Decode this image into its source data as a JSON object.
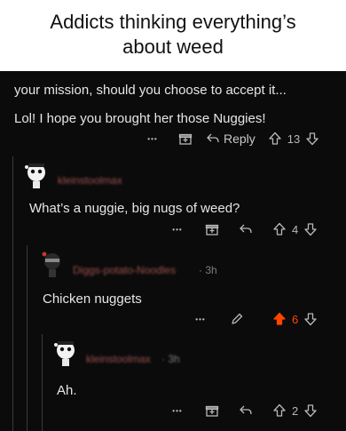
{
  "caption": {
    "line1": "Addicts thinking everything’s",
    "line2": "about weed"
  },
  "comments": [
    {
      "text": "your mission, should you choose to accept it...",
      "actions": {}
    },
    {
      "text": "Lol! I hope you brought her those Nuggies!",
      "actions": {
        "more": "•••",
        "reply": "Reply",
        "score": "13"
      }
    },
    {
      "user": "kleinstoolmax",
      "time": "",
      "text": "What’s a nuggie, big nugs of weed?",
      "actions": {
        "more": "•••",
        "score": "4"
      }
    },
    {
      "user": "Diggs-potato-Noodles",
      "time": "· 3h",
      "text": "Chicken nuggets",
      "actions": {
        "more": "•••",
        "score": "6",
        "upvoted": true
      }
    },
    {
      "user": "kleinstoolmax",
      "time": "· 3h",
      "text": "Ah.",
      "actions": {
        "more": "•••",
        "score": "2"
      }
    }
  ],
  "colors": {
    "background": "#0b0b0b",
    "upvote_active": "#ff4500",
    "username": "#a05050"
  },
  "icons": [
    "award-icon",
    "reply-arrow-icon",
    "upvote-icon",
    "downvote-icon",
    "edit-pencil-icon",
    "avatar-icon"
  ]
}
